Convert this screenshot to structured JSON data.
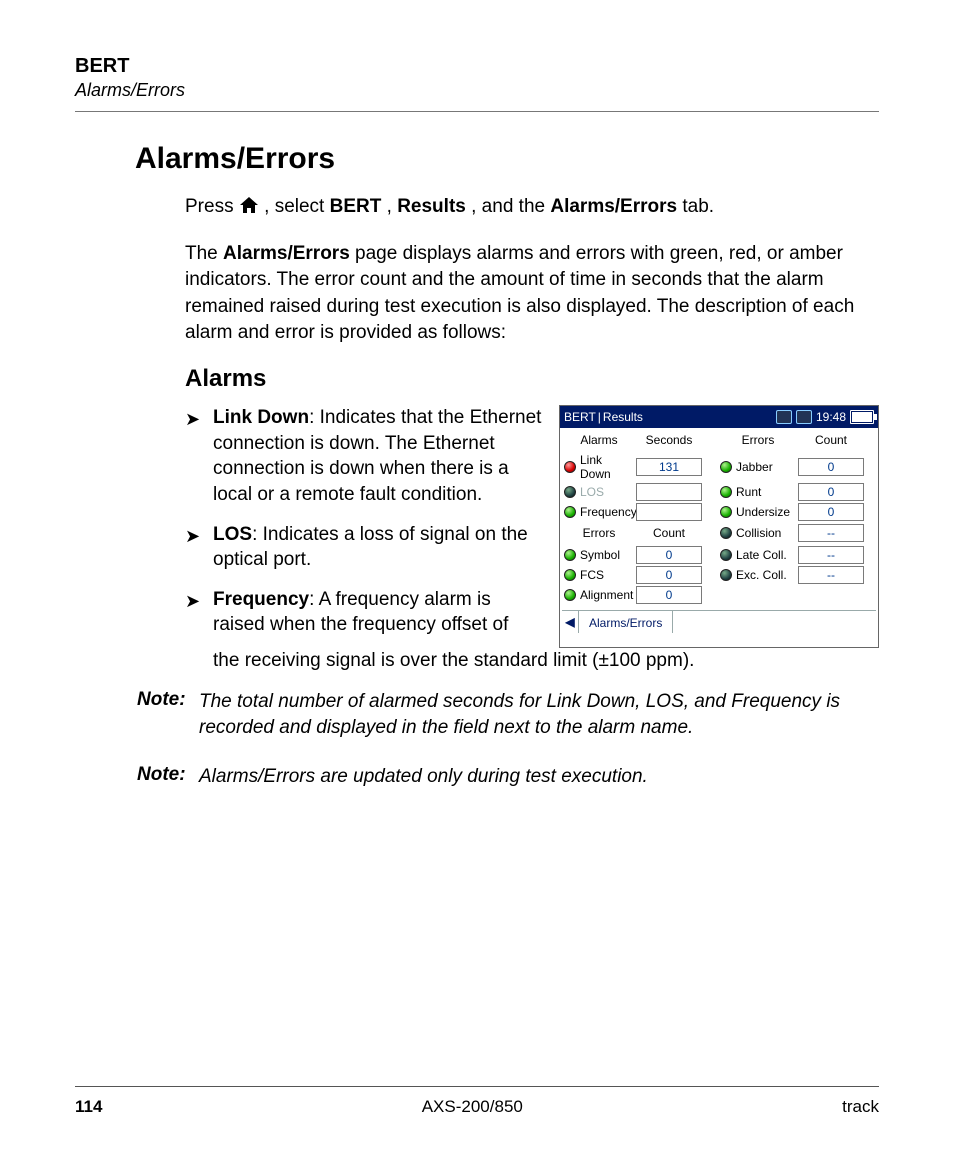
{
  "header": {
    "title": "BERT",
    "subtitle": "Alarms/Errors"
  },
  "section_title": "Alarms/Errors",
  "intro": {
    "p1_a": "Press ",
    "p1_b": ", select ",
    "p1_c": ", ",
    "p1_d": ", and the ",
    "p1_e": " tab.",
    "bert": "BERT",
    "results": "Results",
    "ae_tab": "Alarms/Errors",
    "p2_a": "The ",
    "p2_bold": "Alarms/Errors",
    "p2_b": " page displays alarms and errors with green, red, or amber indicators. The error count and the amount of time in seconds that the alarm remained raised during test execution is also displayed. The description of each alarm and error is provided as follows:"
  },
  "alarms_heading": "Alarms",
  "alarm_items": {
    "link_down": {
      "name": "Link Down",
      "text": ": Indicates that the Ethernet connection is down. The Ethernet connection is down when there is a local or a remote fault condition."
    },
    "los": {
      "name": "LOS",
      "text": ": Indicates a loss of signal on the optical port."
    },
    "freq": {
      "name_a": "Frequency",
      "text_a": ": A frequency alarm is raised when the frequency offset of ",
      "text_b": "the receiving signal is over the standard limit (±100 ppm)."
    }
  },
  "notes": {
    "label": "Note:",
    "n1": "The total number of alarmed seconds for Link Down, LOS, and Frequency is recorded and displayed in the field next to the alarm name.",
    "n2": "Alarms/Errors are updated only during test execution."
  },
  "footer": {
    "page": "114",
    "product": "AXS-200/850"
  },
  "device": {
    "crumb1": "BERT",
    "crumb2": "Results",
    "time": "19:48",
    "headers": {
      "alarms": "Alarms",
      "seconds": "Seconds",
      "errors": "Errors",
      "count": "Count"
    },
    "left_alarms": [
      {
        "led": "red",
        "label": "Link Down",
        "value": "131"
      },
      {
        "led": "off",
        "label": "LOS",
        "value": "",
        "disabled": true
      },
      {
        "led": "green",
        "label": "Frequency",
        "value": ""
      }
    ],
    "left_errors_header": {
      "errors": "Errors",
      "count": "Count"
    },
    "left_errors": [
      {
        "led": "green",
        "label": "Symbol",
        "value": "0"
      },
      {
        "led": "green",
        "label": "FCS",
        "value": "0"
      },
      {
        "led": "green",
        "label": "Alignment",
        "value": "0"
      }
    ],
    "right_errors": [
      {
        "led": "green",
        "label": "Jabber",
        "value": "0"
      },
      {
        "led": "green",
        "label": "Runt",
        "value": "0"
      },
      {
        "led": "green",
        "label": "Undersize",
        "value": "0"
      },
      {
        "led": "off",
        "label": "Collision",
        "value": "--"
      },
      {
        "led": "off",
        "label": "Late Coll.",
        "value": "--"
      },
      {
        "led": "off",
        "label": "Exc. Coll.",
        "value": "--"
      }
    ],
    "tab": "Alarms/Errors"
  }
}
